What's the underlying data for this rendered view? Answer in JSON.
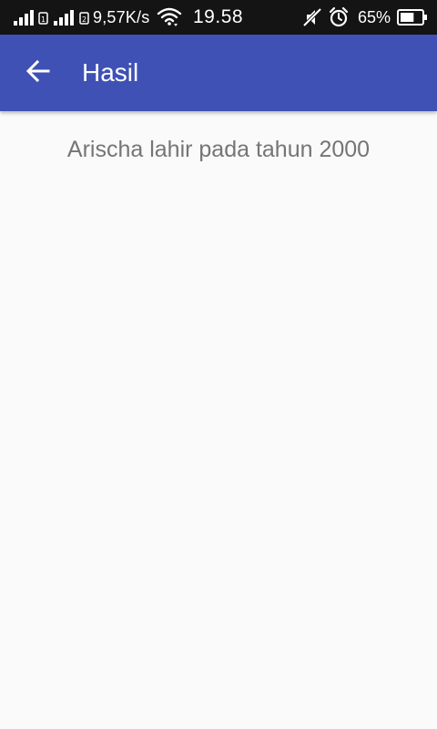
{
  "status_bar": {
    "network_speed": "9,57K/s",
    "time": "19.58",
    "battery_percent": "65%",
    "sim1_label": "1",
    "sim2_label": "2"
  },
  "app_bar": {
    "title": "Hasil",
    "back_icon": "arrow-back-icon",
    "color": "#3f51b5"
  },
  "content": {
    "result_text": "Arischa lahir pada tahun 2000"
  },
  "battery_level": 0.65
}
